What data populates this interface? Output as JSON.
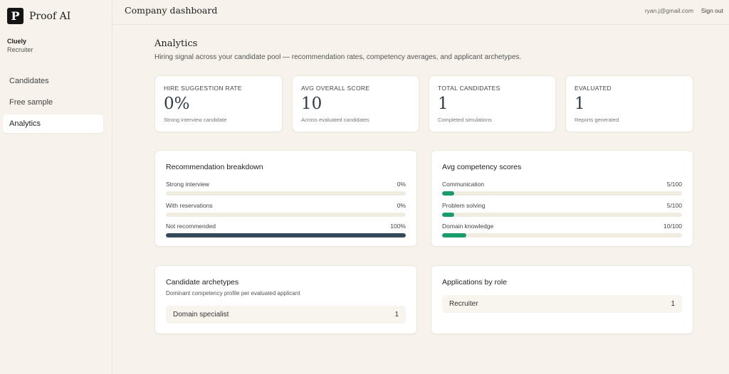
{
  "brand": {
    "logo_letter": "P",
    "name": "Proof AI"
  },
  "org": {
    "name": "Cluely",
    "role": "Recruiter"
  },
  "nav": {
    "items": [
      {
        "label": "Candidates",
        "active": false
      },
      {
        "label": "Free sample",
        "active": false
      },
      {
        "label": "Analytics",
        "active": true
      }
    ]
  },
  "topbar": {
    "title": "Company dashboard",
    "email": "ryan.j@gmail.com",
    "signout": "Sign out"
  },
  "page": {
    "title": "Analytics",
    "subtitle": "Hiring signal across your candidate pool — recommendation rates, competency averages, and applicant archetypes."
  },
  "stats": [
    {
      "label": "HIRE SUGGESTION RATE",
      "value": "0%",
      "note": "Strong interview candidate"
    },
    {
      "label": "AVG OVERALL SCORE",
      "value": "10",
      "note": "Across evaluated candidates"
    },
    {
      "label": "TOTAL CANDIDATES",
      "value": "1",
      "note": "Completed simulations"
    },
    {
      "label": "EVALUATED",
      "value": "1",
      "note": "Reports generated"
    }
  ],
  "recommendation": {
    "title": "Recommendation breakdown",
    "rows": [
      {
        "label": "Strong interview",
        "value": "0%",
        "fraction": 0.0
      },
      {
        "label": "With reservations",
        "value": "0%",
        "fraction": 0.0
      },
      {
        "label": "Not recommended",
        "value": "100%",
        "fraction": 1.0
      }
    ]
  },
  "competency": {
    "title": "Avg competency scores",
    "rows": [
      {
        "label": "Communication",
        "value": "5/100",
        "fraction": 0.05
      },
      {
        "label": "Problem solving",
        "value": "5/100",
        "fraction": 0.05
      },
      {
        "label": "Domain knowledge",
        "value": "10/100",
        "fraction": 0.1
      }
    ]
  },
  "archetypes": {
    "title": "Candidate archetypes",
    "subtitle": "Dominant competency profile per evaluated applicant",
    "items": [
      {
        "label": "Domain specialist",
        "count": "1"
      }
    ]
  },
  "roles": {
    "title": "Applications by role",
    "items": [
      {
        "label": "Recruiter",
        "count": "1"
      }
    ]
  },
  "colors": {
    "background": "#f7f3ec",
    "recommendation_bar": "#34495a",
    "competency_bar": "#1a9b6c",
    "track": "#f1ece2"
  }
}
